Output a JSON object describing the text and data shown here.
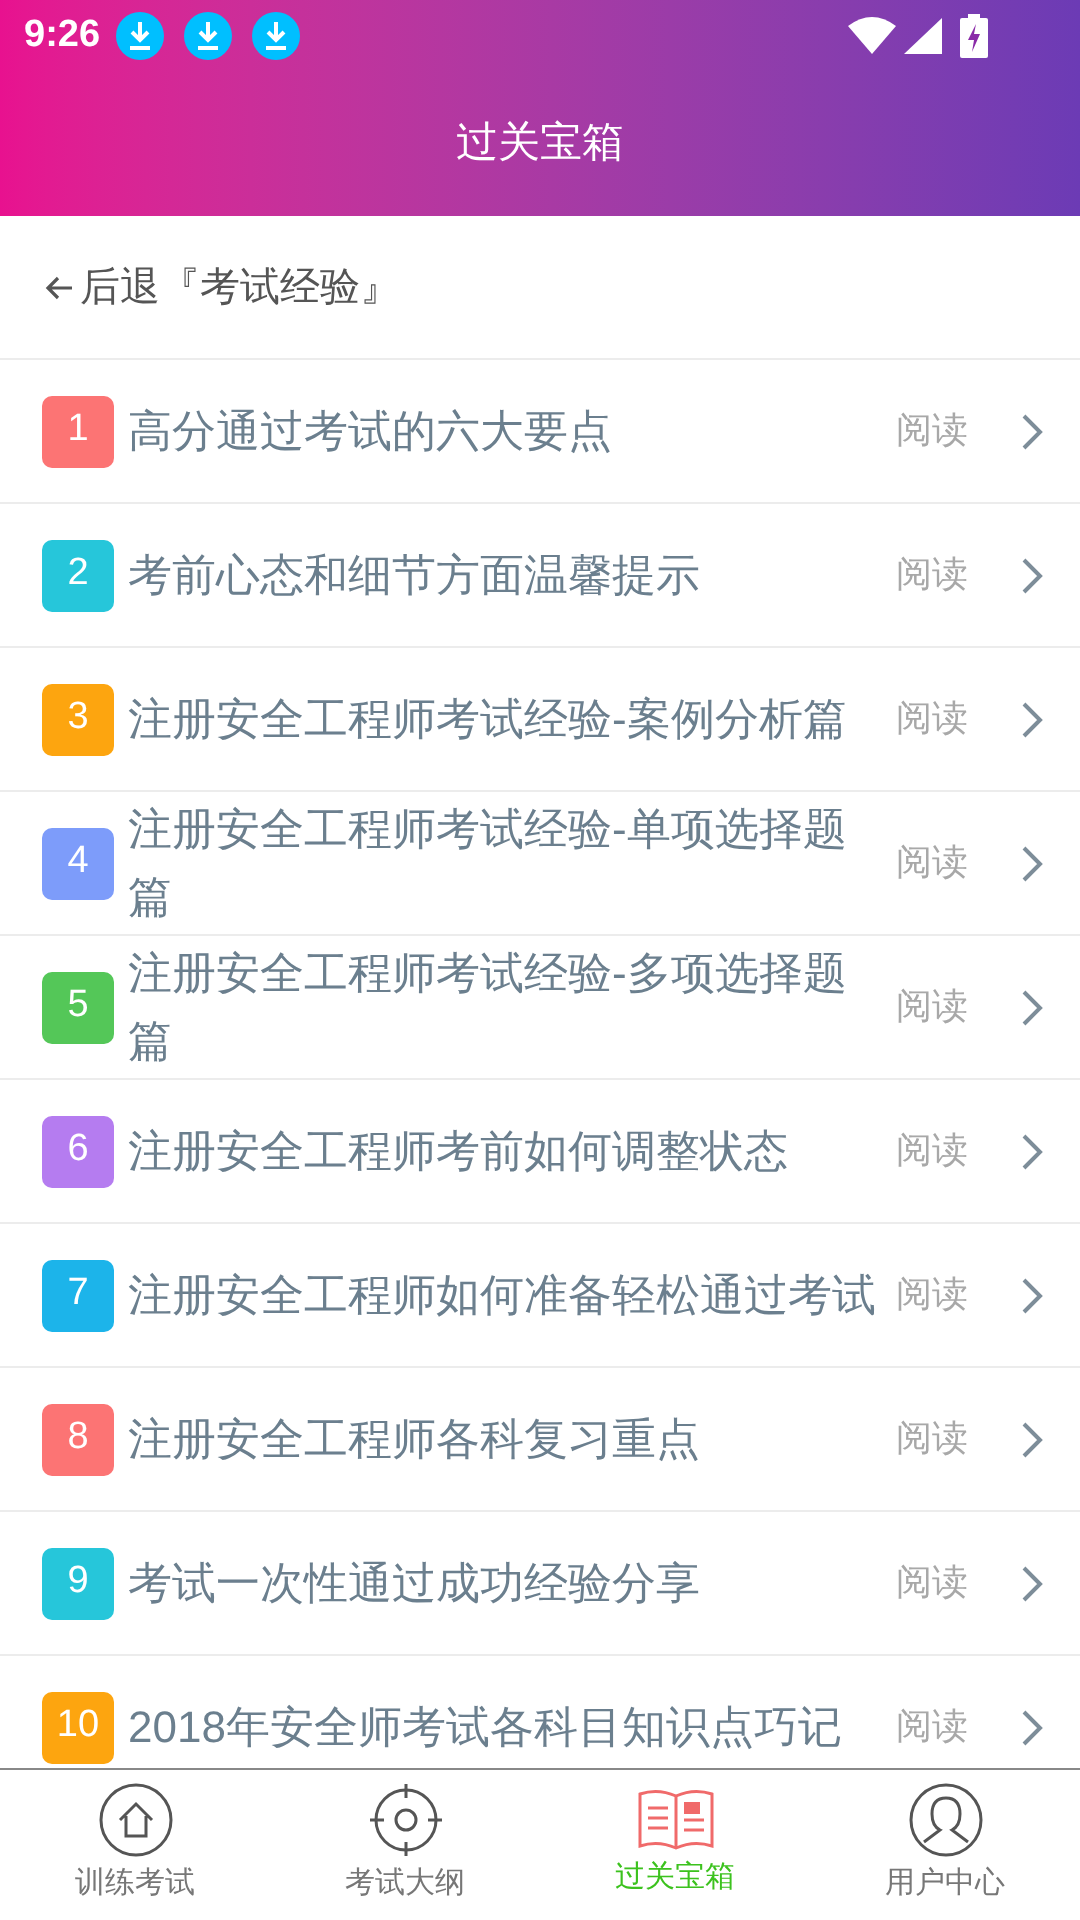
{
  "status_bar": {
    "time": "9:26",
    "notifications": [
      {
        "kind": "download"
      },
      {
        "kind": "download"
      },
      {
        "kind": "download"
      }
    ]
  },
  "header": {
    "title": "过关宝箱"
  },
  "back": {
    "label": "后退『考试经验』"
  },
  "articles": [
    {
      "number": "1",
      "title": "高分通过考试的六大要点",
      "action": "阅读",
      "color": "#fc7474"
    },
    {
      "number": "2",
      "title": "考前心态和细节方面温馨提示",
      "action": "阅读",
      "color": "#26c6da"
    },
    {
      "number": "3",
      "title": "注册安全工程师考试经验-案例分析篇",
      "action": "阅读",
      "color": "#fda50f"
    },
    {
      "number": "4",
      "title": "注册安全工程师考试经验-单项选择题篇",
      "action": "阅读",
      "color": "#7d9cfa"
    },
    {
      "number": "5",
      "title": "注册安全工程师考试经验-多项选择题篇",
      "action": "阅读",
      "color": "#54c758"
    },
    {
      "number": "6",
      "title": "注册安全工程师考前如何调整状态",
      "action": "阅读",
      "color": "#b57cf0"
    },
    {
      "number": "7",
      "title": "注册安全工程师如何准备轻松通过考试",
      "action": "阅读",
      "color": "#1cb4ea"
    },
    {
      "number": "8",
      "title": "注册安全工程师各科复习重点",
      "action": "阅读",
      "color": "#fc7474"
    },
    {
      "number": "9",
      "title": "考试一次性通过成功经验分享",
      "action": "阅读",
      "color": "#26c6da"
    },
    {
      "number": "10",
      "title": "2018年安全师考试各科目知识点巧记",
      "action": "阅读",
      "color": "#fda50f"
    }
  ],
  "tabs": [
    {
      "label": "训练考试",
      "selected": false
    },
    {
      "label": "考试大纲",
      "selected": false
    },
    {
      "label": "过关宝箱",
      "selected": true
    },
    {
      "label": "用户中心",
      "selected": false
    }
  ]
}
